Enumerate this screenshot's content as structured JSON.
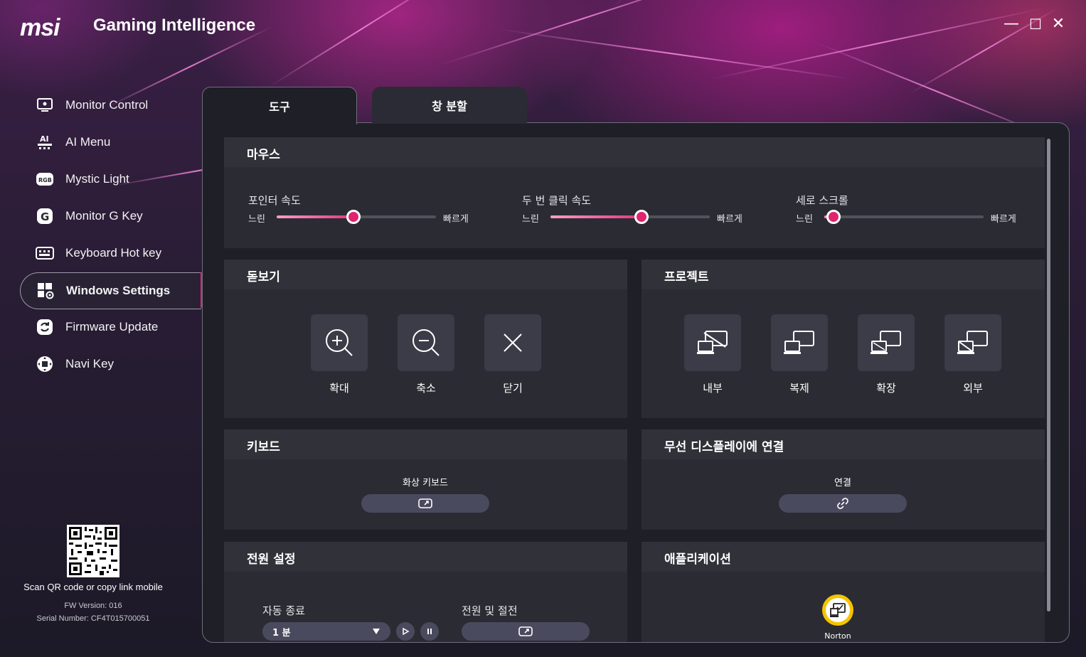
{
  "app": {
    "logo": "msi",
    "title": "Gaming Intelligence"
  },
  "window_controls": {
    "minimize": "—",
    "maximize": "☐",
    "close": "✕"
  },
  "sidebar": {
    "items": [
      {
        "label": "Monitor Control",
        "icon": "monitor-icon"
      },
      {
        "label": "AI Menu",
        "icon": "ai-icon"
      },
      {
        "label": "Mystic Light",
        "icon": "rgb-icon"
      },
      {
        "label": "Monitor G Key",
        "icon": "g-key-icon"
      },
      {
        "label": "Keyboard Hot key",
        "icon": "keyboard-icon"
      },
      {
        "label": "Windows Settings",
        "icon": "windows-settings-icon",
        "active": true
      },
      {
        "label": "Firmware Update",
        "icon": "firmware-icon"
      },
      {
        "label": "Navi Key",
        "icon": "navi-key-icon"
      }
    ],
    "rgb_badge": "RGB",
    "qr_caption": "Scan QR code or copy link mobile",
    "fw_version": "FW Version: 016",
    "serial": "Serial Number: CF4T015700051"
  },
  "tabs": [
    {
      "label": "도구",
      "active": true
    },
    {
      "label": "창 분할",
      "active": false
    }
  ],
  "mouse": {
    "title": "마우스",
    "sliders": [
      {
        "label": "포인터 속도",
        "min_label": "느린",
        "max_label": "빠르게",
        "value_fraction": 0.48
      },
      {
        "label": "두 번 클릭 속도",
        "min_label": "느린",
        "max_label": "빠르게",
        "value_fraction": 0.57
      },
      {
        "label": "세로 스크롤",
        "min_label": "느린",
        "max_label": "빠르게",
        "value_fraction": 0.06
      }
    ]
  },
  "magnifier": {
    "title": "돋보기",
    "buttons": [
      {
        "label": "확대",
        "icon": "zoom-in-icon"
      },
      {
        "label": "축소",
        "icon": "zoom-out-icon"
      },
      {
        "label": "닫기",
        "icon": "close-icon"
      }
    ]
  },
  "project": {
    "title": "프로젝트",
    "buttons": [
      {
        "label": "내부",
        "icon": "pc-screen-only-icon"
      },
      {
        "label": "복제",
        "icon": "duplicate-icon"
      },
      {
        "label": "확장",
        "icon": "extend-icon"
      },
      {
        "label": "외부",
        "icon": "second-screen-only-icon"
      }
    ]
  },
  "keyboard": {
    "title": "키보드",
    "on_screen_label": "화상 키보드",
    "button_icon": "launch-icon"
  },
  "wireless": {
    "title": "무선 디스플레이에 연결",
    "connect_label": "연결",
    "button_icon": "link-icon"
  },
  "power": {
    "title": "전원 설정",
    "auto_off_label": "자동 종료",
    "auto_off_value": "1 분",
    "sleep_label": "전원 및 절전",
    "button_icon": "launch-icon"
  },
  "apps": {
    "title": "애플리케이션",
    "items": [
      {
        "label": "Norton",
        "icon": "norton-icon"
      }
    ]
  },
  "colors": {
    "accent": "#e0246f",
    "panel": "#1f1f27",
    "section": "#2b2b33",
    "norton_yellow": "#f5c400"
  }
}
